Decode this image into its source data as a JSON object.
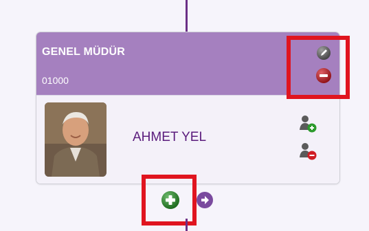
{
  "node": {
    "title": "GENEL MÜDÜR",
    "code": "01000",
    "person_name": "AHMET YEL"
  },
  "colors": {
    "header_bg": "#a580bf",
    "name_text": "#5a1b7c",
    "connector": "#6b2f86",
    "highlight": "#e0151f",
    "add_green": "#2c9a2c",
    "remove_red": "#d01c24",
    "nav_purple": "#7a4a9e"
  },
  "icons": [
    "pencil-icon",
    "minus-circle-icon",
    "user-add-icon",
    "user-remove-icon",
    "plus-circle-icon",
    "arrow-right-circle-icon"
  ]
}
